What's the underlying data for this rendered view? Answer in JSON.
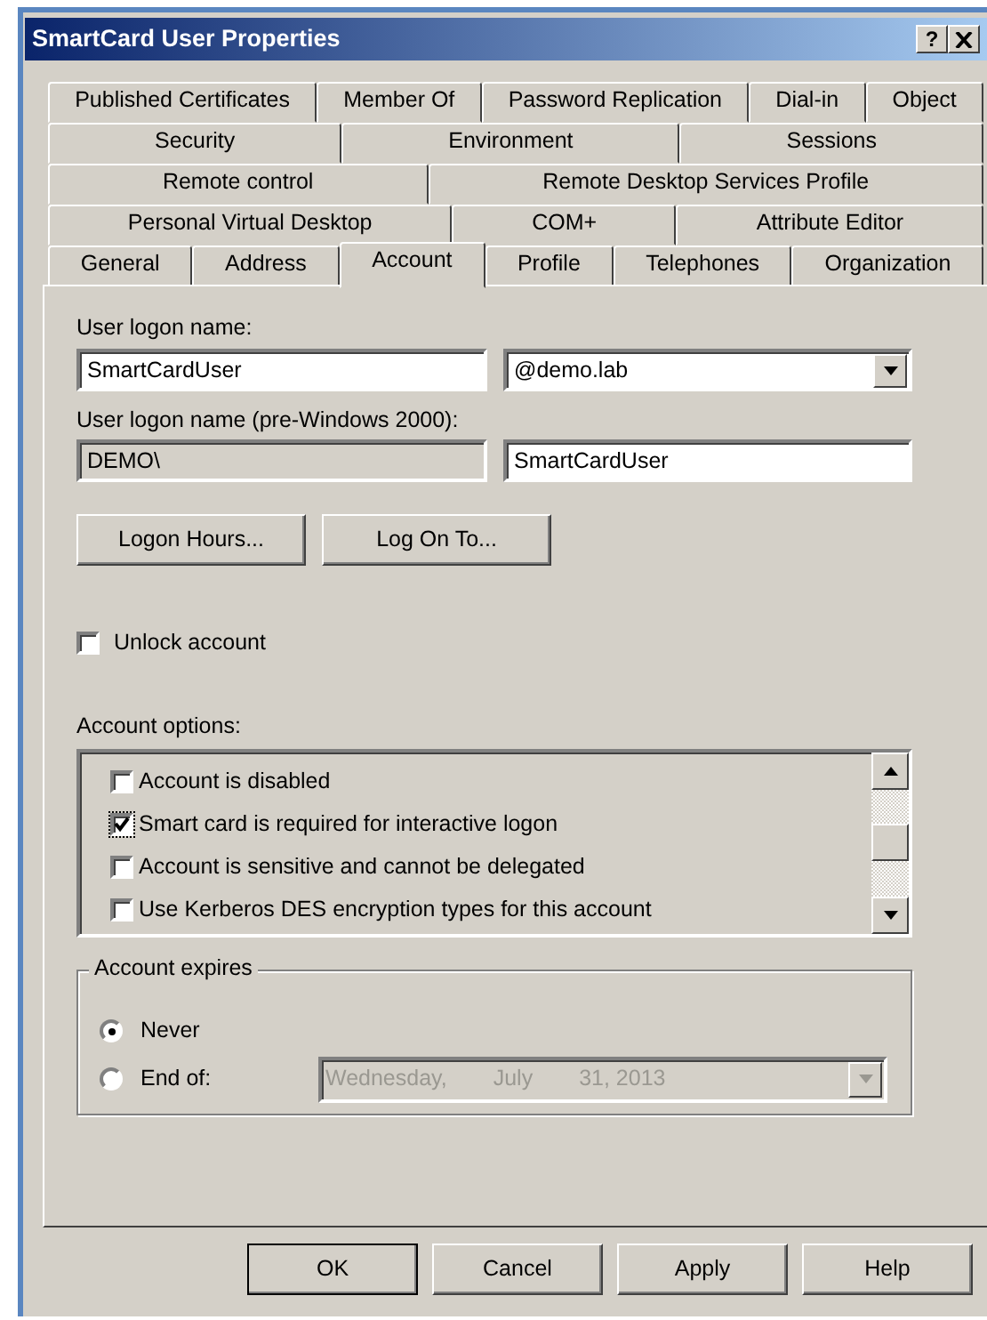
{
  "window": {
    "title": "SmartCard User Properties",
    "help_button": "?"
  },
  "tab_rows": [
    [
      {
        "label": "Published Certificates",
        "selected": false
      },
      {
        "label": "Member Of",
        "selected": false
      },
      {
        "label": "Password Replication",
        "selected": false
      },
      {
        "label": "Dial-in",
        "selected": false
      },
      {
        "label": "Object",
        "selected": false
      }
    ],
    [
      {
        "label": "Security",
        "selected": false
      },
      {
        "label": "Environment",
        "selected": false
      },
      {
        "label": "Sessions",
        "selected": false
      }
    ],
    [
      {
        "label": "Remote control",
        "selected": false
      },
      {
        "label": "Remote Desktop Services Profile",
        "selected": false
      }
    ],
    [
      {
        "label": "Personal Virtual Desktop",
        "selected": false
      },
      {
        "label": "COM+",
        "selected": false
      },
      {
        "label": "Attribute Editor",
        "selected": false
      }
    ],
    [
      {
        "label": "General",
        "selected": false
      },
      {
        "label": "Address",
        "selected": false
      },
      {
        "label": "Account",
        "selected": true
      },
      {
        "label": "Profile",
        "selected": false
      },
      {
        "label": "Telephones",
        "selected": false
      },
      {
        "label": "Organization",
        "selected": false
      }
    ]
  ],
  "logon_name": {
    "label": "User logon name:",
    "value": "SmartCardUser",
    "suffix": "@demo.lab"
  },
  "pre_windows_2000": {
    "label": "User logon name (pre-Windows 2000):",
    "domain": "DEMO\\",
    "value": "SmartCardUser"
  },
  "account_buttons": [
    "Logon Hours...",
    "Log On To..."
  ],
  "unlock": {
    "label": "Unlock account",
    "checked": false
  },
  "account_options": {
    "label": "Account options:",
    "items": [
      {
        "label": "Account is disabled",
        "checked": false
      },
      {
        "label": "Smart card is required for interactive logon",
        "checked": true
      },
      {
        "label": "Account is sensitive and cannot be delegated",
        "checked": false
      },
      {
        "label": "Use Kerberos DES encryption types for this account",
        "checked": false
      }
    ]
  },
  "account_expires": {
    "legend": "Account expires",
    "options": [
      {
        "label": "Never",
        "selected": true
      },
      {
        "label": "End of:",
        "selected": false
      }
    ],
    "date": {
      "disabled": true,
      "parts": [
        "Wednesday,",
        "July",
        "31, 2013"
      ]
    }
  },
  "footer_buttons": [
    {
      "label": "OK",
      "default": true
    },
    {
      "label": "Cancel",
      "default": false
    },
    {
      "label": "Apply",
      "default": false
    },
    {
      "label": "Help",
      "default": false
    }
  ]
}
